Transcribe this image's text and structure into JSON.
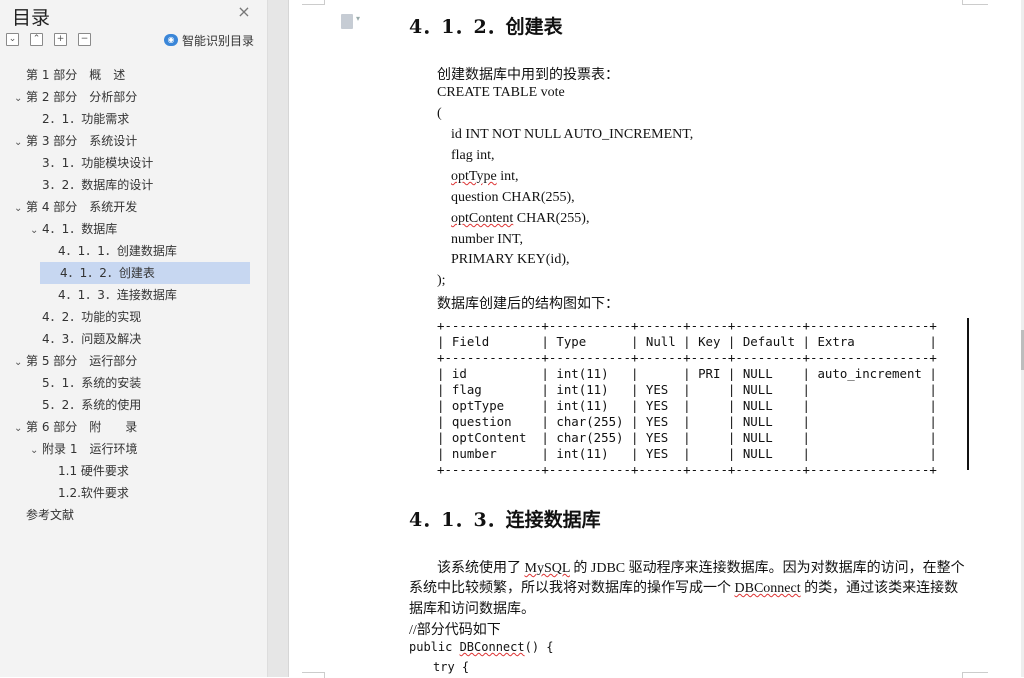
{
  "sidebar": {
    "title": "目录",
    "close_symbol": "×",
    "toolbar": [
      {
        "icon": "collapse-all-icon",
        "glyph": "⌄"
      },
      {
        "icon": "expand-all-icon",
        "glyph": "⌃"
      },
      {
        "icon": "add-icon",
        "glyph": "+"
      },
      {
        "icon": "remove-icon",
        "glyph": "−"
      }
    ],
    "smart_label": "智能识别目录",
    "items": [
      {
        "label": "第 1 部分　概　述",
        "caret": ""
      },
      {
        "label": "第 2 部分　分析部分",
        "caret": "v"
      },
      {
        "label": "2．1．功能需求",
        "caret": ""
      },
      {
        "label": "第 3 部分　系统设计",
        "caret": "v"
      },
      {
        "label": "3．1．功能模块设计",
        "caret": ""
      },
      {
        "label": "3．2．数据库的设计",
        "caret": ""
      },
      {
        "label": "第 4 部分　系统开发",
        "caret": "v"
      },
      {
        "label": "4．1．数据库",
        "caret": "v"
      },
      {
        "label": "4．1．1．创建数据库",
        "caret": ""
      },
      {
        "label": "4．1．2．创建表",
        "caret": "",
        "selected": true
      },
      {
        "label": "4．1．3．连接数据库",
        "caret": ""
      },
      {
        "label": "4．2．功能的实现",
        "caret": ""
      },
      {
        "label": "4．3．问题及解决",
        "caret": ""
      },
      {
        "label": "第 5 部分　运行部分",
        "caret": "v"
      },
      {
        "label": "5．1．系统的安装",
        "caret": ""
      },
      {
        "label": "5．2．系统的使用",
        "caret": ""
      },
      {
        "label": "第 6 部分　附　　录",
        "caret": "v"
      },
      {
        "label": "附录 1　运行环境",
        "caret": "v"
      },
      {
        "label": "1.1 硬件要求",
        "caret": ""
      },
      {
        "label": "1.2.软件要求",
        "caret": ""
      },
      {
        "label": "参考文献",
        "caret": ""
      }
    ]
  },
  "document": {
    "heading1": "4．1．2．创建表",
    "intro": "创建数据库中用到的投票表：",
    "sql": {
      "l1": "CREATE TABLE vote",
      "l2": "(",
      "l3": "id INT NOT NULL AUTO_INCREMENT,",
      "l4": "flag int,",
      "l5a": "optType",
      "l5b": " int,",
      "l6": "question CHAR(255),",
      "l7a": "optContent",
      "l7b": " CHAR(255),",
      "l8": "number INT,",
      "l9": "PRIMARY KEY(id),",
      "l10": ");"
    },
    "after_sql": "数据库创建后的结构图如下：",
    "table_text": "+-------------+-----------+------+-----+---------+----------------+\n| Field       | Type      | Null | Key | Default | Extra          |\n+-------------+-----------+------+-----+---------+----------------+\n| id          | int(11)   |      | PRI | NULL    | auto_increment |\n| flag        | int(11)   | YES  |     | NULL    |                |\n| optType     | int(11)   | YES  |     | NULL    |                |\n| question    | char(255) | YES  |     | NULL    |                |\n| optContent  | char(255) | YES  |     | NULL    |                |\n| number      | int(11)   | YES  |     | NULL    |                |\n+-------------+-----------+------+-----+---------+----------------+",
    "heading2": "4．1．3．连接数据库",
    "para1a": "该系统使用了 ",
    "para1_mysql": "MySQL",
    "para1b": " 的 JDBC 驱动程序来连接数据库。因为对数据库的访问，在整个",
    "para2a": "系统中比较频繁，所以我将对数据库的操作写成一个 ",
    "para2_db": "DBConnect",
    "para2b": " 的类，通过该类来连接数",
    "para3": "据库和访问数据库。",
    "comment": "//部分代码如下",
    "code1a": "public ",
    "code1_db": "DBConnect",
    "code1b": "() {",
    "code2": "try {"
  }
}
